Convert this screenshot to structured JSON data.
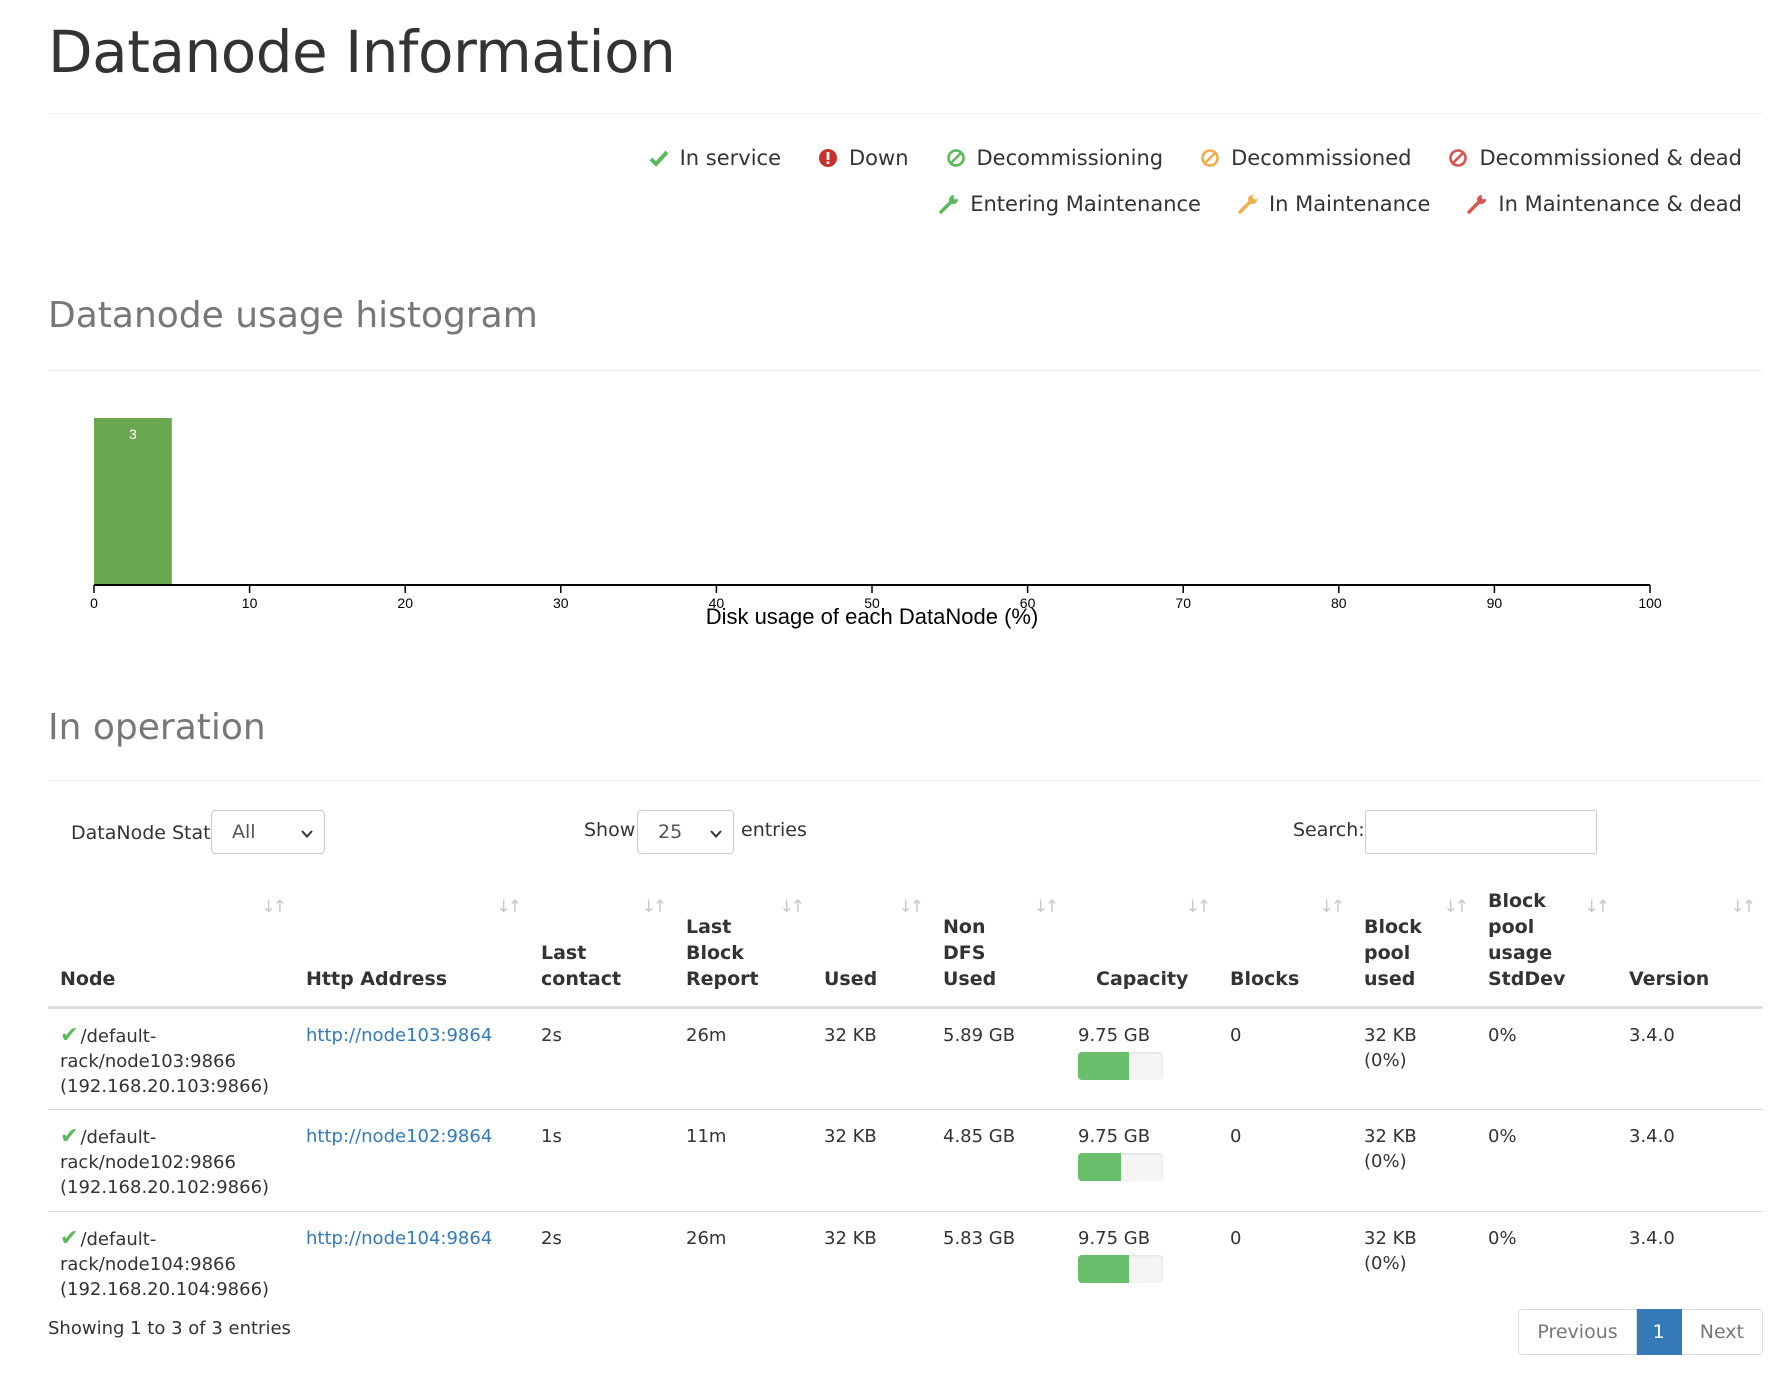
{
  "page_title": "Datanode Information",
  "legend": {
    "row1": [
      {
        "icon": "check-icon",
        "label": "In service",
        "color": "#5cb85c"
      },
      {
        "icon": "exclamation-circle-icon",
        "label": "Down",
        "color": "#c9302c"
      },
      {
        "icon": "ban-icon",
        "label": "Decommissioning",
        "color": "#5cb85c"
      },
      {
        "icon": "ban-icon",
        "label": "Decommissioned",
        "color": "#f0ad4e"
      },
      {
        "icon": "ban-icon",
        "label": "Decommissioned & dead",
        "color": "#d9534f"
      }
    ],
    "row2": [
      {
        "icon": "wrench-icon",
        "label": "Entering Maintenance",
        "color": "#5cb85c"
      },
      {
        "icon": "wrench-icon",
        "label": "In Maintenance",
        "color": "#f0ad4e"
      },
      {
        "icon": "wrench-icon",
        "label": "In Maintenance & dead",
        "color": "#d9534f"
      }
    ]
  },
  "histogram_title": "Datanode usage histogram",
  "chart_data": {
    "type": "bar",
    "bins": [
      {
        "from": 0,
        "to": 5,
        "count": 3
      }
    ],
    "xlabel": "Disk usage of each DataNode (%)",
    "xlim": [
      0,
      100
    ],
    "xticks": [
      0,
      10,
      20,
      30,
      40,
      50,
      60,
      70,
      80,
      90,
      100
    ],
    "ymax": 3,
    "bar_color": "#6aa84f"
  },
  "operation_title": "In operation",
  "controls": {
    "state_label": "DataNode State",
    "state_value": "All",
    "show_label": "Show",
    "show_value": "25",
    "entries_label": "entries",
    "search_label": "Search:"
  },
  "table": {
    "headers": [
      "Node",
      "Http Address",
      "Last contact",
      "Last Block Report",
      "Used",
      "Non DFS Used",
      "Capacity",
      "Blocks",
      "Block pool used",
      "Block pool usage StdDev",
      "Version"
    ],
    "rows": [
      {
        "node": "/default-rack/node103:9866 (192.168.20.103:9866)",
        "http": "http://node103:9864",
        "last_contact": "2s",
        "last_block_report": "26m",
        "used": "32 KB",
        "non_dfs_used": "5.89 GB",
        "capacity": "9.75 GB",
        "capacity_used_fraction": 0.6,
        "blocks": "0",
        "block_pool_used": "32 KB (0%)",
        "stddev": "0%",
        "version": "3.4.0"
      },
      {
        "node": "/default-rack/node102:9866 (192.168.20.102:9866)",
        "http": "http://node102:9864",
        "last_contact": "1s",
        "last_block_report": "11m",
        "used": "32 KB",
        "non_dfs_used": "4.85 GB",
        "capacity": "9.75 GB",
        "capacity_used_fraction": 0.5,
        "blocks": "0",
        "block_pool_used": "32 KB (0%)",
        "stddev": "0%",
        "version": "3.4.0"
      },
      {
        "node": "/default-rack/node104:9866 (192.168.20.104:9866)",
        "http": "http://node104:9864",
        "last_contact": "2s",
        "last_block_report": "26m",
        "used": "32 KB",
        "non_dfs_used": "5.83 GB",
        "capacity": "9.75 GB",
        "capacity_used_fraction": 0.6,
        "blocks": "0",
        "block_pool_used": "32 KB (0%)",
        "stddev": "0%",
        "version": "3.4.0"
      }
    ]
  },
  "info_text": "Showing 1 to 3 of 3 entries",
  "pagination": {
    "previous": "Previous",
    "current": "1",
    "next": "Next"
  }
}
